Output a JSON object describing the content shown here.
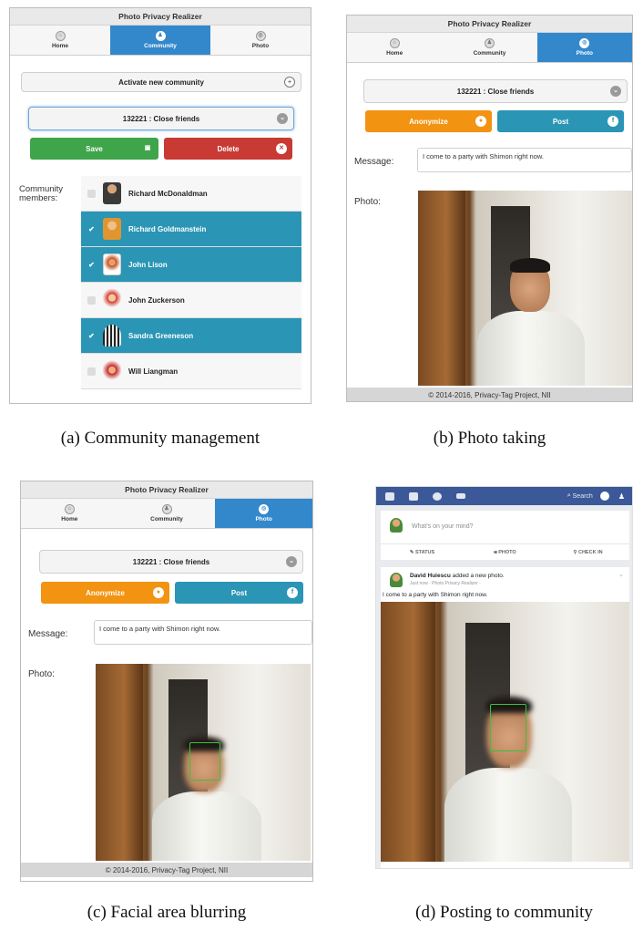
{
  "app": {
    "title": "Photo Privacy Realizer",
    "nav": {
      "home": "Home",
      "community": "Community",
      "photo": "Photo"
    },
    "footer": "© 2014-2016, Privacy-Tag Project, NII"
  },
  "panel_a": {
    "activate_label": "Activate new community",
    "select_value": "132221 : Close friends",
    "save_label": "Save",
    "delete_label": "Delete",
    "members_label": "Community\nmembers:",
    "members": [
      {
        "name": "Richard McDonaldman",
        "checked": false,
        "avatar": "#3a3a3a"
      },
      {
        "name": "Richard Goldmanstein",
        "checked": true,
        "avatar": "#e0952f"
      },
      {
        "name": "John Lison",
        "checked": true,
        "avatar": "#c44a1c"
      },
      {
        "name": "John Zuckerson",
        "checked": false,
        "avatar": "#d53b2f"
      },
      {
        "name": "Sandra Greeneson",
        "checked": true,
        "avatar": "#3b3b3b"
      },
      {
        "name": "Will Liangman",
        "checked": false,
        "avatar": "#c8252a"
      }
    ],
    "colors": {
      "save": "#3fa54a",
      "delete": "#c83a33",
      "checked": "#2a95b5",
      "nav_active": "#3388cc"
    }
  },
  "panel_b": {
    "select_value": "132221 : Close friends",
    "anonymize_label": "Anonymize",
    "post_label": "Post",
    "message_label": "Message:",
    "message_value": "I come to a party with Shimon right now.",
    "photo_label": "Photo:"
  },
  "panel_c": {
    "select_value": "132221 : Close friends",
    "anonymize_label": "Anonymize",
    "post_label": "Post",
    "message_label": "Message:",
    "message_value": "I come to a party with Shimon right now.",
    "photo_label": "Photo:"
  },
  "panel_d": {
    "search_label": "Search",
    "composer_placeholder": "What's on your mind?",
    "actions": {
      "status": "STATUS",
      "photo": "PHOTO",
      "checkin": "CHECK IN"
    },
    "post_author": "David Huiescu",
    "post_action": "added a new photo.",
    "post_meta": "Just now · Photo Privacy Realizer ·",
    "post_text": "I come to a party with Shimon right now.",
    "colors": {
      "fb_blue": "#3b5998"
    }
  },
  "captions": {
    "a": "(a) Community management",
    "b": "(b) Photo taking",
    "c": "(c) Facial area blurring",
    "d": "(d) Posting to community"
  },
  "colors": {
    "anonymize": "#f39312",
    "post": "#2a95b5",
    "face_box": "#39c23b"
  }
}
